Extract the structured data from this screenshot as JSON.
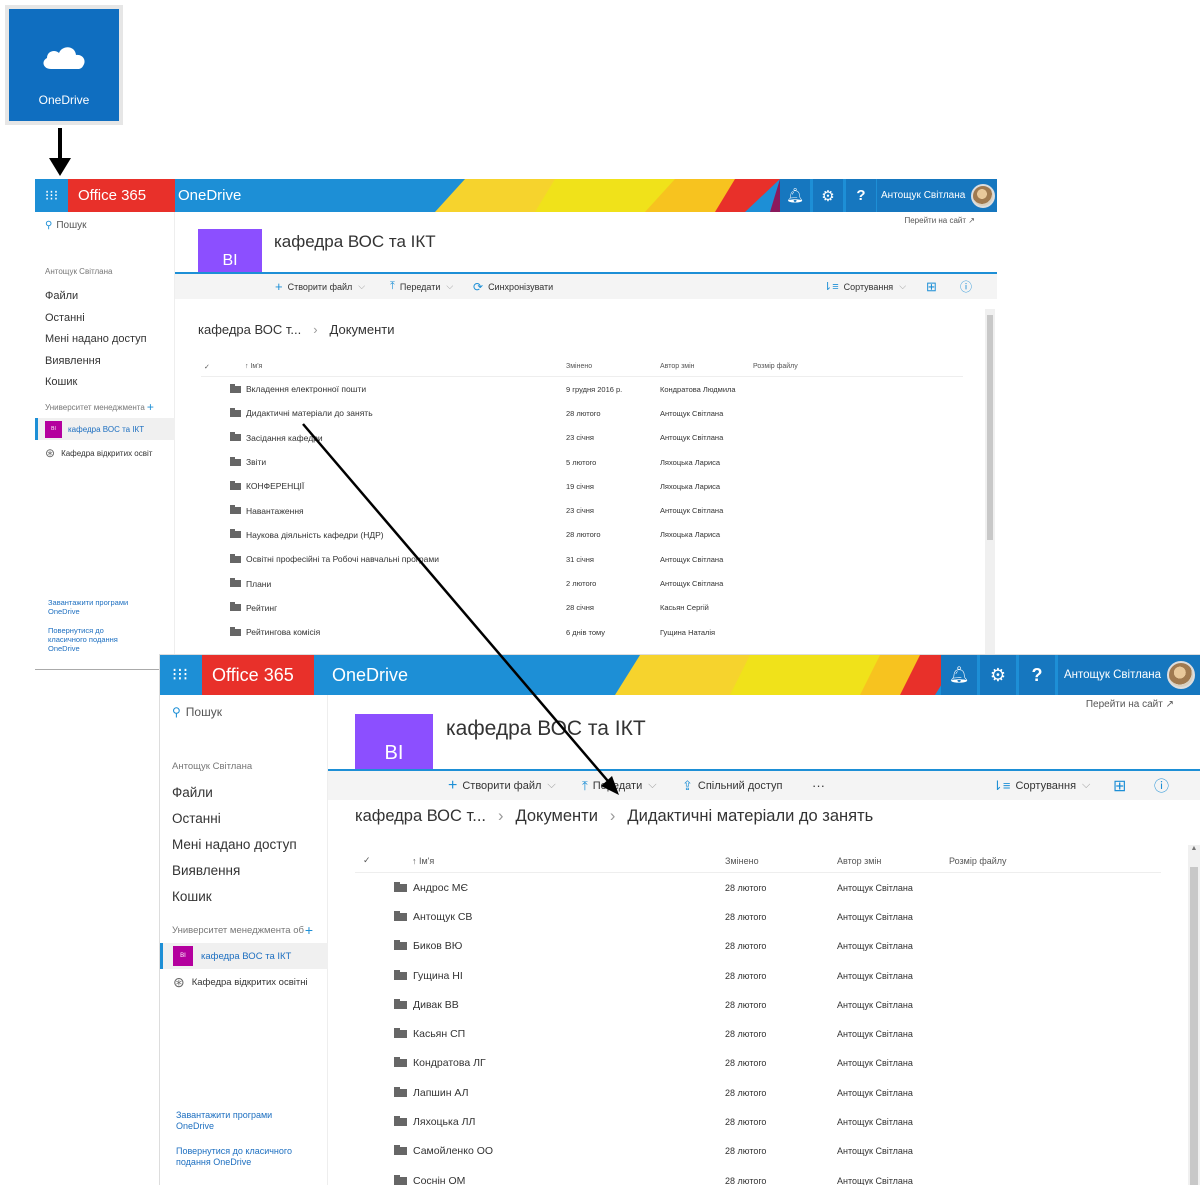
{
  "tile": {
    "label": "OneDrive"
  },
  "win1": {
    "brand": "Office 365",
    "app": "OneDrive",
    "user": "Антощук Світлана",
    "search": "Пошук",
    "owner": "Антощук Світлана",
    "nav": [
      "Файли",
      "Останні",
      "Мені надано доступ",
      "Виявлення",
      "Кошик"
    ],
    "group": "Университет менеджмента",
    "sites": [
      {
        "badge": "ВІ",
        "label": "кафедра ВОС та ІКТ"
      },
      {
        "badge": "",
        "label": "Кафедра відкритих освіт"
      }
    ],
    "links": [
      "Завантажити програми OneDrive",
      "Повернутися до класичного подання OneDrive"
    ],
    "badge": "ВІ",
    "title": "кафедра ВОС та ІКТ",
    "goto": "Перейти на сайт ↗",
    "cmds": [
      "Створити файл",
      "Передати",
      "Синхронізувати"
    ],
    "sort": "Сортування",
    "bread": [
      "кафедра ВОС т...",
      "Документи"
    ],
    "cols": [
      "Ім'я",
      "Змінено",
      "Автор змін",
      "Розмір файлу"
    ],
    "rows": [
      {
        "name": "Вкладення електронної пошти",
        "mod": "9 грудня 2016 р.",
        "by": "Кондратова Людмила"
      },
      {
        "name": "Дидактичні матеріали до занять",
        "mod": "28 лютого",
        "by": "Антощук Світлана"
      },
      {
        "name": "Засідання кафедри",
        "mod": "23 січня",
        "by": "Антощук Світлана"
      },
      {
        "name": "Звіти",
        "mod": "5 лютого",
        "by": "Ляхоцька Лариса"
      },
      {
        "name": "КОНФЕРЕНЦІЇ",
        "mod": "19 січня",
        "by": "Ляхоцька Лариса"
      },
      {
        "name": "Навантаження",
        "mod": "23 січня",
        "by": "Антощук Світлана"
      },
      {
        "name": "Наукова діяльність кафедри (НДР)",
        "mod": "28 лютого",
        "by": "Ляхоцька Лариса"
      },
      {
        "name": "Освітні професійні та Робочі навчальні програми",
        "mod": "31 січня",
        "by": "Антощук Світлана"
      },
      {
        "name": "Плани",
        "mod": "2 лютого",
        "by": "Антощук Світлана"
      },
      {
        "name": "Рейтинг",
        "mod": "28 січня",
        "by": "Касьян Сергій"
      },
      {
        "name": "Рейтингова комісія",
        "mod": "6 днів тому",
        "by": "Гущина Наталія"
      }
    ]
  },
  "win2": {
    "brand": "Office 365",
    "app": "OneDrive",
    "user": "Антощук Світлана",
    "search": "Пошук",
    "owner": "Антощук Світлана",
    "nav": [
      "Файли",
      "Останні",
      "Мені надано доступ",
      "Виявлення",
      "Кошик"
    ],
    "group": "Университет менеджмента об",
    "sites": [
      {
        "badge": "ВІ",
        "label": "кафедра ВОС та ІКТ"
      },
      {
        "badge": "",
        "label": "Кафедра відкритих освітні"
      }
    ],
    "links": [
      "Завантажити програми OneDrive",
      "Повернутися до класичного подання OneDrive"
    ],
    "badge": "ВІ",
    "title": "кафедра ВОС та ІКТ",
    "goto": "Перейти на сайт ↗",
    "cmds": [
      "Створити файл",
      "Передати",
      "Спільний доступ",
      "···"
    ],
    "sort": "Сортування",
    "bread": [
      "кафедра ВОС т...",
      "Документи",
      "Дидактичні матеріали до занять"
    ],
    "cols": [
      "Ім'я",
      "Змінено",
      "Автор змін",
      "Розмір файлу"
    ],
    "rows": [
      {
        "name": "Андрос МЄ",
        "mod": "28 лютого",
        "by": "Антощук Світлана"
      },
      {
        "name": "Антощук СВ",
        "mod": "28 лютого",
        "by": "Антощук Світлана"
      },
      {
        "name": "Биков ВЮ",
        "mod": "28 лютого",
        "by": "Антощук Світлана"
      },
      {
        "name": "Гущина НІ",
        "mod": "28 лютого",
        "by": "Антощук Світлана"
      },
      {
        "name": "Дивак ВВ",
        "mod": "28 лютого",
        "by": "Антощук Світлана"
      },
      {
        "name": "Касьян СП",
        "mod": "28 лютого",
        "by": "Антощук Світлана"
      },
      {
        "name": "Кондратова ЛГ",
        "mod": "28 лютого",
        "by": "Антощук Світлана"
      },
      {
        "name": "Лапшин АЛ",
        "mod": "28 лютого",
        "by": "Антощук Світлана"
      },
      {
        "name": "Ляхоцька ЛЛ",
        "mod": "28 лютого",
        "by": "Антощук Світлана"
      },
      {
        "name": "Самойленко ОО",
        "mod": "28 лютого",
        "by": "Антощук Світлана"
      },
      {
        "name": "Соснін ОМ",
        "mod": "28 лютого",
        "by": "Антощук Світлана"
      }
    ]
  },
  "colors": {
    "blue": "#1d8fd6",
    "red": "#e8302a",
    "purple": "#8c4fff",
    "magenta": "#b4009e"
  }
}
